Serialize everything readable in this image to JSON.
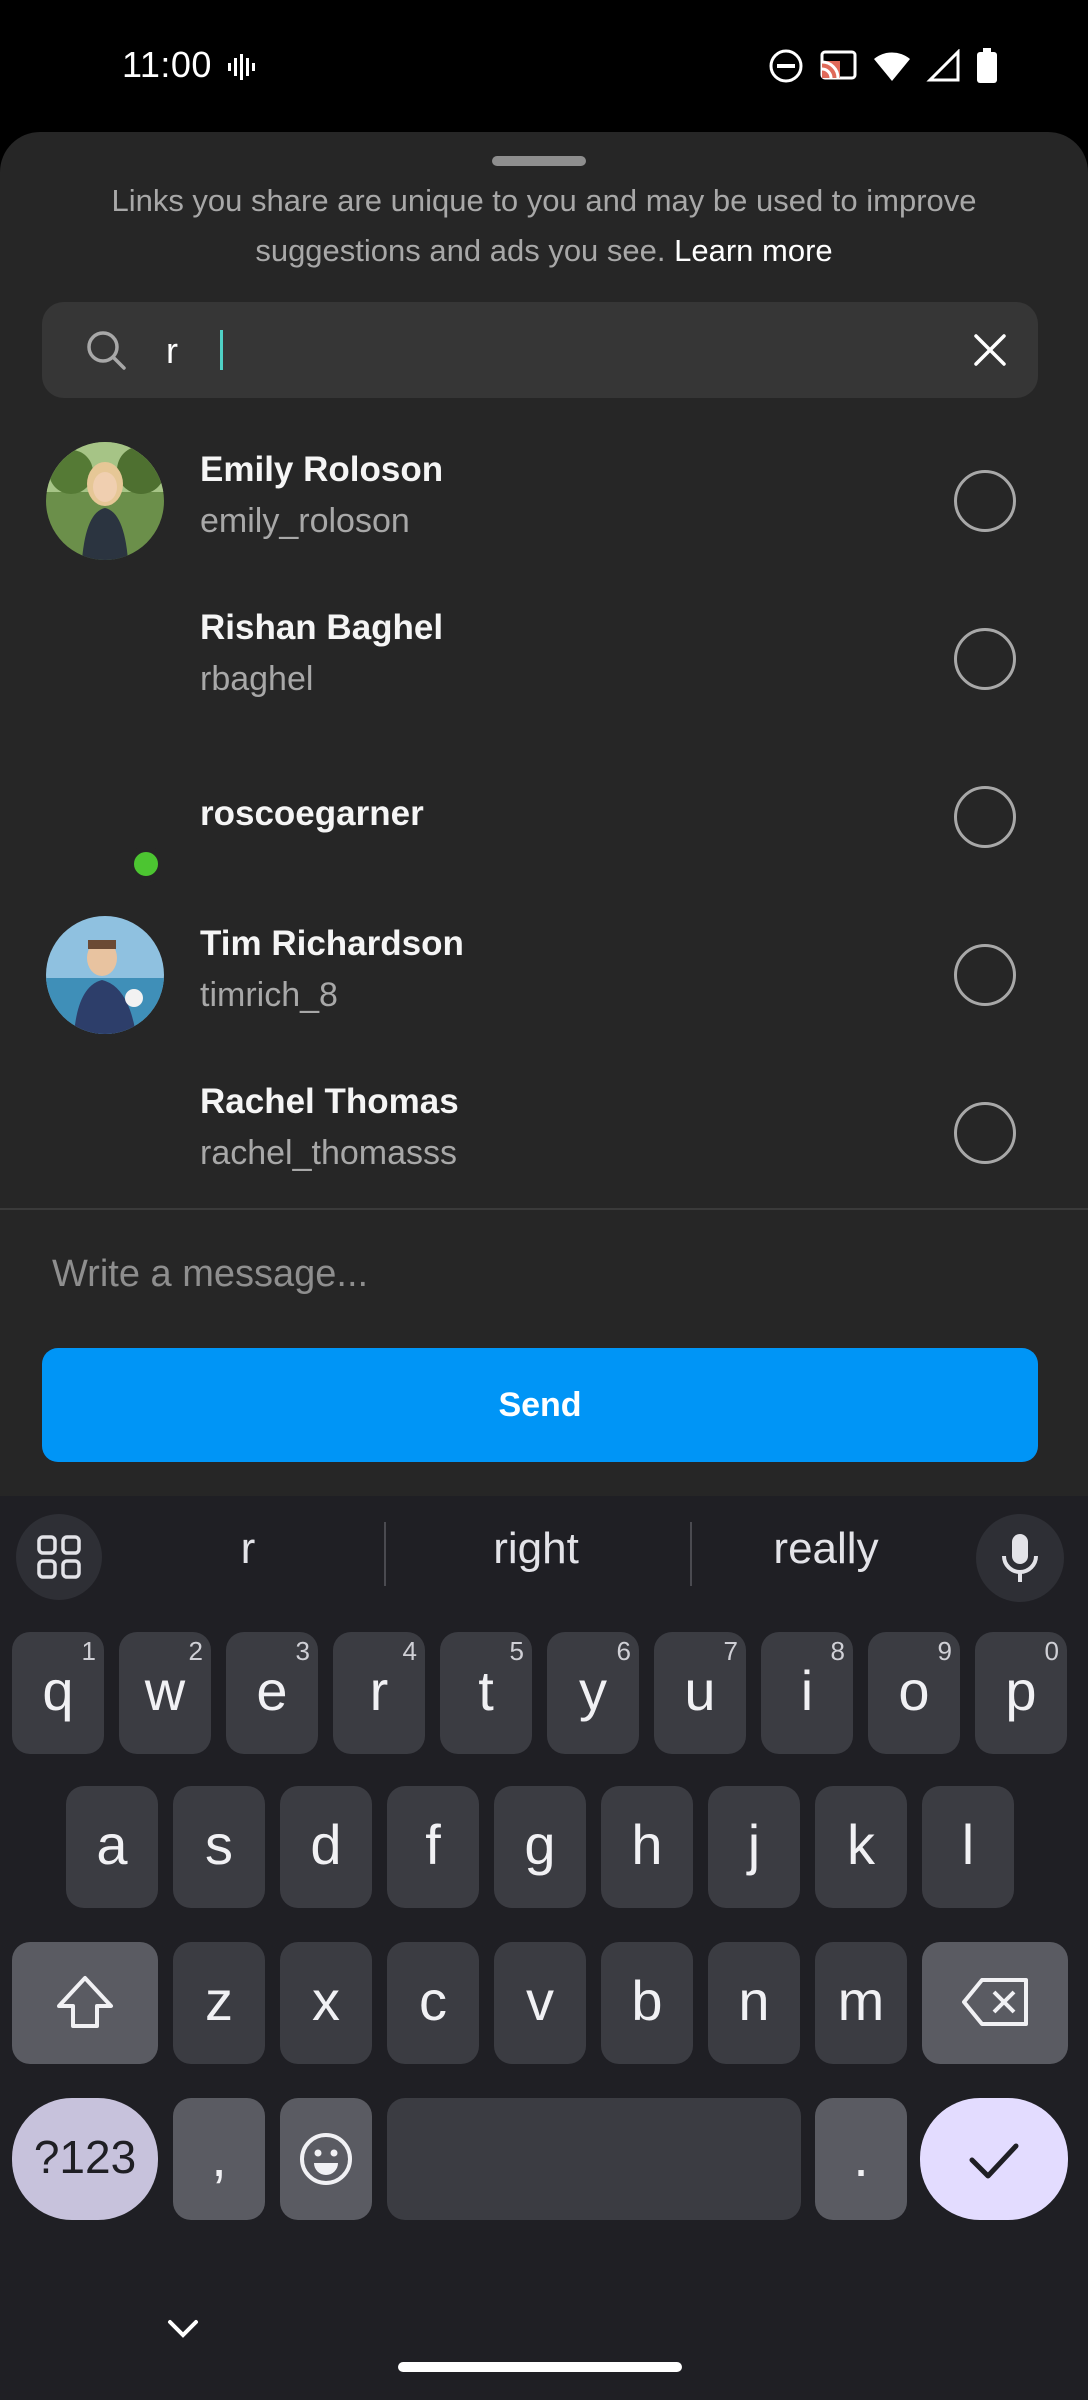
{
  "status_bar": {
    "time": "11:00",
    "left_icon": "vibrate-icon",
    "right_icons": [
      "dnd-icon",
      "cast-icon",
      "wifi-icon",
      "signal-icon",
      "battery-icon"
    ]
  },
  "share_sheet": {
    "notice_text": "Links you share are unique to you and may be used to improve suggestions and ads you see.",
    "learn_more_label": "Learn more",
    "search": {
      "value": "r",
      "placeholder": ""
    },
    "contacts": [
      {
        "name": "Emily Roloson",
        "username": "emily_roloson",
        "has_avatar": true,
        "online": false
      },
      {
        "name": "Rishan Baghel",
        "username": "rbaghel",
        "has_avatar": false,
        "online": false
      },
      {
        "name": "roscoegarner",
        "username": "",
        "has_avatar": false,
        "online": true
      },
      {
        "name": "Tim Richardson",
        "username": "timrich_8",
        "has_avatar": true,
        "online": false
      },
      {
        "name": "Rachel Thomas",
        "username": "rachel_thomasss",
        "has_avatar": false,
        "online": false
      }
    ],
    "message_placeholder": "Write a message...",
    "send_label": "Send"
  },
  "keyboard": {
    "suggestions": [
      "r",
      "right",
      "really"
    ],
    "row1": [
      {
        "key": "q",
        "hint": "1"
      },
      {
        "key": "w",
        "hint": "2"
      },
      {
        "key": "e",
        "hint": "3"
      },
      {
        "key": "r",
        "hint": "4"
      },
      {
        "key": "t",
        "hint": "5"
      },
      {
        "key": "y",
        "hint": "6"
      },
      {
        "key": "u",
        "hint": "7"
      },
      {
        "key": "i",
        "hint": "8"
      },
      {
        "key": "o",
        "hint": "9"
      },
      {
        "key": "p",
        "hint": "0"
      }
    ],
    "row2": [
      "a",
      "s",
      "d",
      "f",
      "g",
      "h",
      "j",
      "k",
      "l"
    ],
    "row3": [
      "z",
      "x",
      "c",
      "v",
      "b",
      "n",
      "m"
    ],
    "mode_label": "?123",
    "comma_label": ",",
    "period_label": "."
  },
  "colors": {
    "sheet_bg": "#262626",
    "send_button": "#0095f6",
    "online_dot": "#4cc531",
    "keyboard_bg": "#1f1f24"
  }
}
